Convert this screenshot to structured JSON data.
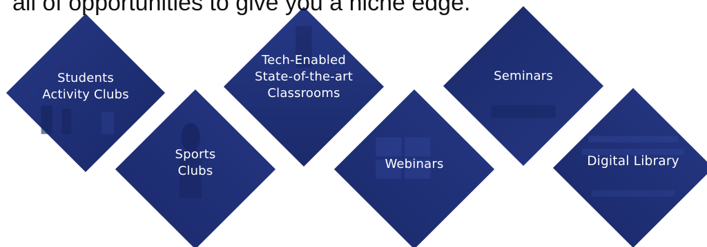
{
  "intro_text": "all of opportunities to give you a niche edge.",
  "colors": {
    "tile_base": "#1f2f78",
    "tile_dark": "#1a2866",
    "tile_light": "#2a3d8c",
    "text": "#ffffff"
  },
  "tiles": [
    {
      "id": "students",
      "label": "Students\nActivity Clubs"
    },
    {
      "id": "sports",
      "label": "Sports\nClubs"
    },
    {
      "id": "tech",
      "label": "Tech-Enabled\nState-of-the-art\nClassrooms"
    },
    {
      "id": "webinars",
      "label": "Webinars"
    },
    {
      "id": "seminars",
      "label": "Seminars"
    },
    {
      "id": "library",
      "label": "Digital Library"
    }
  ]
}
